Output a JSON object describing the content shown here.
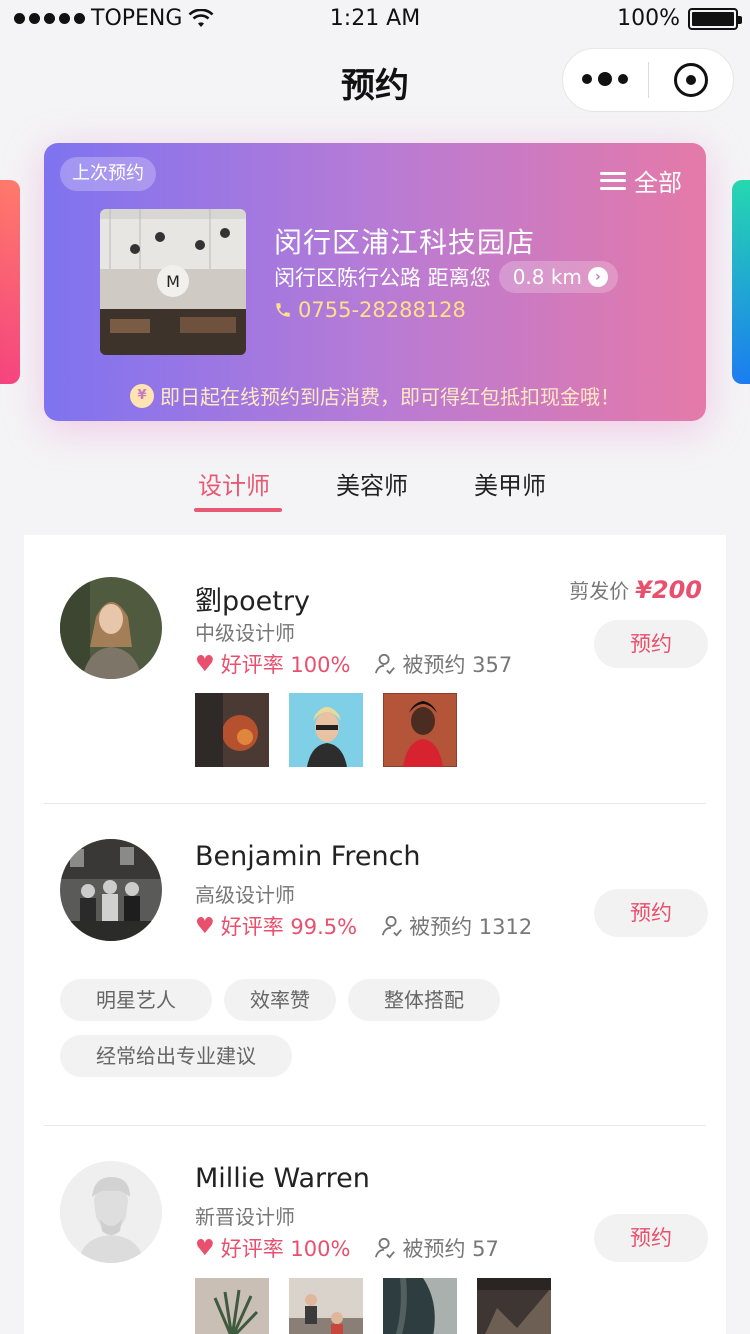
{
  "status_bar": {
    "carrier": "TOPENG",
    "time": "1:21 AM",
    "battery": "100%"
  },
  "nav": {
    "title": "预约"
  },
  "colors": {
    "accent": "#e85a73",
    "card_gradient_start": "#7f73f0",
    "card_gradient_end": "#e57aa8"
  },
  "shop": {
    "last_tag": "上次预约",
    "all_label": "全部",
    "name": "闵行区浦江科技园店",
    "address": "闵行区陈行公路 距离您",
    "distance": "0.8 km",
    "phone": "0755-28288128",
    "tip": "即日起在线预约到店消费，即可得红包抵扣现金哦！",
    "photo_sign": "M"
  },
  "tabs": [
    {
      "label": "设计师",
      "active": true
    },
    {
      "label": "美容师",
      "active": false
    },
    {
      "label": "美甲师",
      "active": false
    }
  ],
  "stylists": [
    {
      "name": "劉poetry",
      "level": "中级设计师",
      "rating": "好评率 100%",
      "booked": "被预约 357",
      "price_label": "剪发价",
      "price": "¥200",
      "book_label": "预约"
    },
    {
      "name": "Benjamin French",
      "level": "高级设计师",
      "rating": "好评率 99.5%",
      "booked": "被预约 1312",
      "book_label": "预约",
      "tags": [
        "明星艺人",
        "效率赞",
        "整体搭配",
        "经常给出专业建议"
      ]
    },
    {
      "name": "Millie Warren",
      "level": "新晋设计师",
      "rating": "好评率 100%",
      "booked": "被预约 57",
      "book_label": "预约"
    }
  ]
}
